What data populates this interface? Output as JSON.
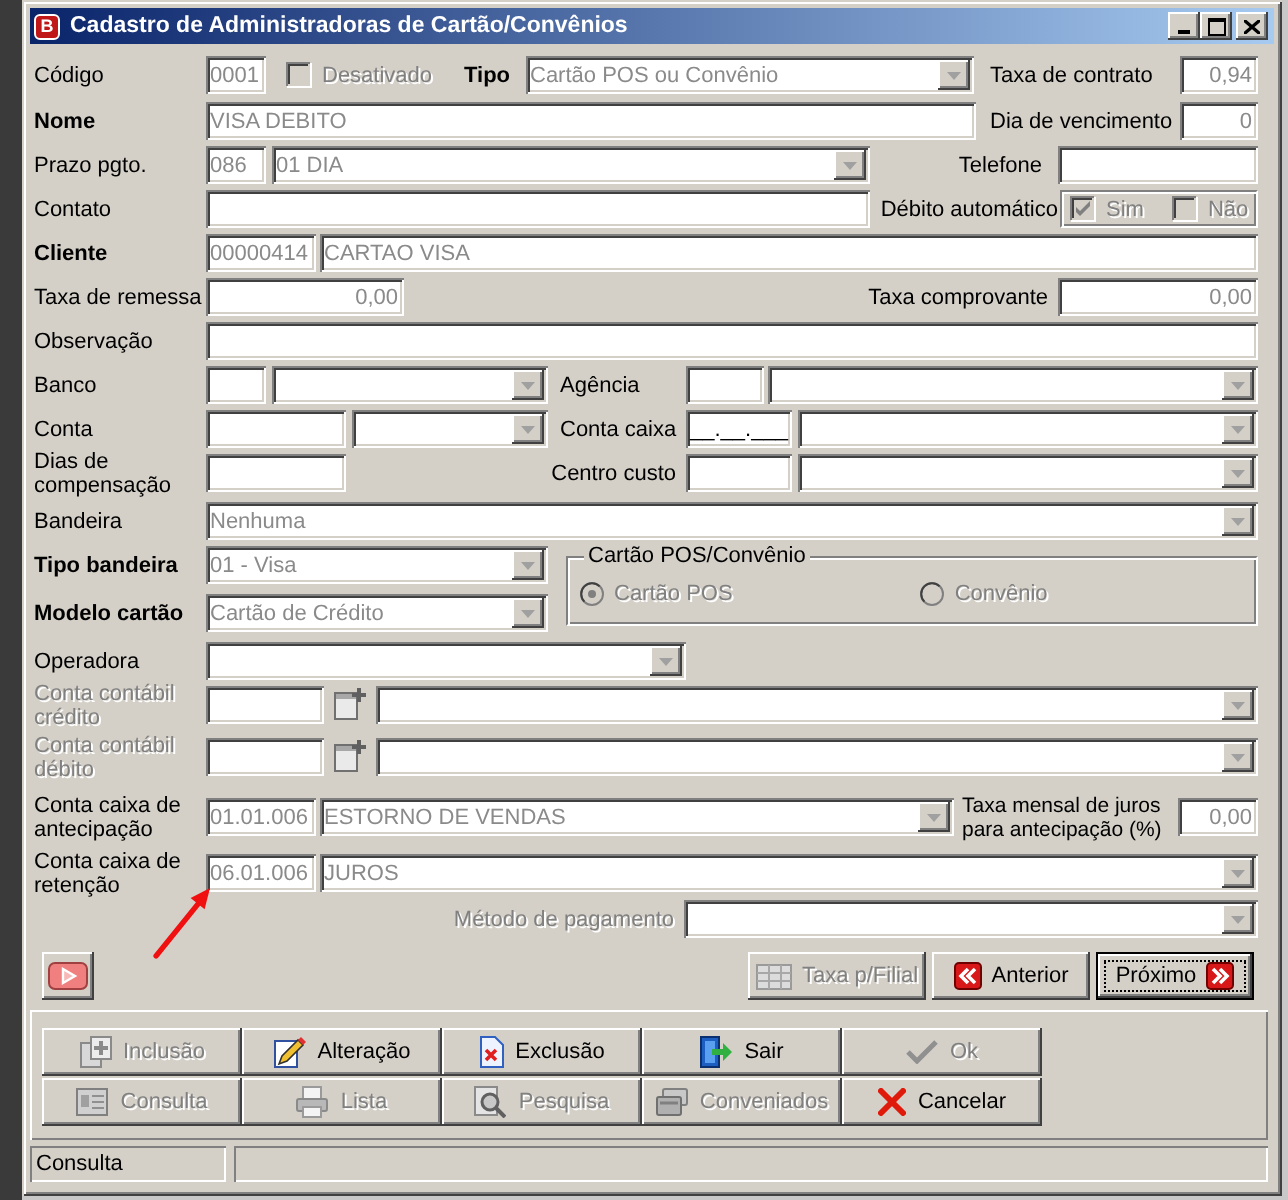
{
  "window": {
    "title": "Cadastro de Administradoras de Cartão/Convênios",
    "icon_letter": "B"
  },
  "read_only": true,
  "rows": [
    {
      "items": [
        {
          "kind": "label",
          "text": "Código",
          "required": false,
          "disabled": false
        },
        {
          "kind": "edit",
          "value": "0001"
        },
        {
          "kind": "checkbox",
          "label": "Desativado",
          "checked": false,
          "disabled": true
        },
        {
          "kind": "label",
          "text": "Tipo",
          "required": true,
          "disabled": false
        },
        {
          "kind": "combo",
          "value": "Cartão POS ou Convênio"
        },
        {
          "kind": "label",
          "text": "Taxa de contrato",
          "required": false,
          "disabled": false
        },
        {
          "kind": "edit",
          "value": "0,94"
        }
      ]
    },
    {
      "items": [
        {
          "kind": "label",
          "text": "Nome",
          "required": true,
          "disabled": false
        },
        {
          "kind": "edit",
          "value": "VISA DEBITO"
        },
        {
          "kind": "label",
          "text": "Dia de vencimento",
          "required": false,
          "disabled": false
        },
        {
          "kind": "edit",
          "value": "0"
        }
      ]
    },
    {
      "items": [
        {
          "kind": "label",
          "text": "Prazo pgto.",
          "required": false,
          "disabled": false
        },
        {
          "kind": "edit",
          "value": "086"
        },
        {
          "kind": "combo",
          "value": "01 DIA"
        },
        {
          "kind": "label",
          "text": "Telefone",
          "required": false,
          "disabled": false
        },
        {
          "kind": "edit"
        }
      ]
    },
    {
      "items": [
        {
          "kind": "label",
          "text": "Contato",
          "required": false,
          "disabled": false
        },
        {
          "kind": "edit"
        },
        {
          "kind": "label",
          "text": "Débito automático",
          "required": false,
          "disabled": false
        },
        {
          "kind": "checkgroup",
          "disabled": true,
          "options": [
            {
              "label": "Sim",
              "checked": true
            },
            {
              "label": "Não",
              "checked": false
            }
          ]
        }
      ]
    },
    {
      "items": [
        {
          "kind": "label",
          "text": "Cliente",
          "required": true,
          "disabled": false
        },
        {
          "kind": "edit",
          "value": "00000414"
        },
        {
          "kind": "edit",
          "value": "CARTAO VISA"
        }
      ]
    },
    {
      "items": [
        {
          "kind": "label",
          "text": "Taxa de remessa",
          "required": false,
          "disabled": false
        },
        {
          "kind": "edit",
          "value": "0,00"
        },
        {
          "kind": "label",
          "text": "Taxa comprovante",
          "required": false,
          "disabled": false
        },
        {
          "kind": "edit",
          "value": "0,00"
        }
      ]
    },
    {
      "items": [
        {
          "kind": "label",
          "text": "Observação",
          "required": false,
          "disabled": false
        },
        {
          "kind": "edit"
        }
      ]
    },
    {
      "items": [
        {
          "kind": "label",
          "text": "Banco",
          "required": false,
          "disabled": false
        },
        {
          "kind": "edit"
        },
        {
          "kind": "combo"
        },
        {
          "kind": "label",
          "text": "Agência",
          "required": false,
          "disabled": false
        },
        {
          "kind": "edit"
        },
        {
          "kind": "combo"
        }
      ]
    },
    {
      "items": [
        {
          "kind": "label",
          "text": "Conta",
          "required": false,
          "disabled": false
        },
        {
          "kind": "edit"
        },
        {
          "kind": "combo"
        },
        {
          "kind": "label",
          "text": "Conta caixa",
          "required": false,
          "disabled": false
        },
        {
          "kind": "edit",
          "mask": "__.__.___"
        },
        {
          "kind": "combo"
        }
      ]
    },
    {
      "items": [
        {
          "kind": "label",
          "text": "Dias de compensação",
          "required": false,
          "disabled": false
        },
        {
          "kind": "edit"
        },
        {
          "kind": "label",
          "text": "Centro custo",
          "required": false,
          "disabled": false
        },
        {
          "kind": "edit"
        },
        {
          "kind": "combo"
        }
      ]
    },
    {
      "items": [
        {
          "kind": "label",
          "text": "Bandeira",
          "required": false,
          "disabled": false
        },
        {
          "kind": "combo",
          "value": "Nenhuma"
        }
      ]
    },
    {
      "items": [
        {
          "kind": "label",
          "text": "Tipo bandeira",
          "required": true,
          "disabled": false
        },
        {
          "kind": "combo",
          "value": "01 - Visa"
        },
        {
          "kind": "radiogroup",
          "title": "Cartão POS/Convênio",
          "disabled": true,
          "options": [
            {
              "label": "Cartão POS",
              "selected": true
            },
            {
              "label": "Convênio",
              "selected": false
            }
          ]
        }
      ]
    },
    {
      "items": [
        {
          "kind": "label",
          "text": "Modelo cartão",
          "required": true,
          "disabled": false
        },
        {
          "kind": "combo",
          "value": "Cartão de Crédito"
        }
      ]
    },
    {
      "items": [
        {
          "kind": "label",
          "text": "Operadora",
          "required": false,
          "disabled": false
        },
        {
          "kind": "combo"
        }
      ]
    },
    {
      "items": [
        {
          "kind": "label",
          "text": "Conta contábil crédito",
          "required": false,
          "disabled": true
        },
        {
          "kind": "edit"
        },
        {
          "kind": "lookup"
        },
        {
          "kind": "combo"
        }
      ]
    },
    {
      "items": [
        {
          "kind": "label",
          "text": "Conta contábil débito",
          "required": false,
          "disabled": true
        },
        {
          "kind": "edit"
        },
        {
          "kind": "lookup"
        },
        {
          "kind": "combo"
        }
      ]
    },
    {
      "items": [
        {
          "kind": "label",
          "text": "Conta caixa de antecipação",
          "required": false,
          "disabled": false
        },
        {
          "kind": "edit",
          "value": "01.01.006"
        },
        {
          "kind": "combo",
          "value": "ESTORNO DE VENDAS"
        },
        {
          "kind": "label",
          "text": "Taxa mensal de juros para antecipação (%)",
          "required": false,
          "disabled": false
        },
        {
          "kind": "edit",
          "value": "0,00"
        }
      ]
    },
    {
      "items": [
        {
          "kind": "label",
          "text": "Conta caixa de retenção",
          "required": false,
          "disabled": false
        },
        {
          "kind": "edit",
          "value": "06.01.006"
        },
        {
          "kind": "combo",
          "value": "JUROS"
        }
      ]
    },
    {
      "items": [
        {
          "kind": "label",
          "text": "Método de pagamento",
          "required": false,
          "disabled": true
        },
        {
          "kind": "combo"
        }
      ]
    }
  ],
  "nav_buttons": [
    {
      "label": "Taxa p/Filial",
      "disabled": true,
      "focused": false
    },
    {
      "label": "Anterior",
      "disabled": false,
      "focused": false
    },
    {
      "label": "Próximo",
      "disabled": false,
      "focused": true
    }
  ],
  "action_buttons": [
    {
      "label": "Inclusão",
      "disabled": true
    },
    {
      "label": "Alteração",
      "disabled": false
    },
    {
      "label": "Exclusão",
      "disabled": false
    },
    {
      "label": "Sair",
      "disabled": false
    },
    {
      "label": "Ok",
      "disabled": true
    },
    {
      "label": "Consulta",
      "disabled": true
    },
    {
      "label": "Lista",
      "disabled": true
    },
    {
      "label": "Pesquisa",
      "disabled": true
    },
    {
      "label": "Conveniados",
      "disabled": true
    },
    {
      "label": "Cancelar",
      "disabled": false
    }
  ],
  "status_bar": {
    "text": "Consulta"
  }
}
